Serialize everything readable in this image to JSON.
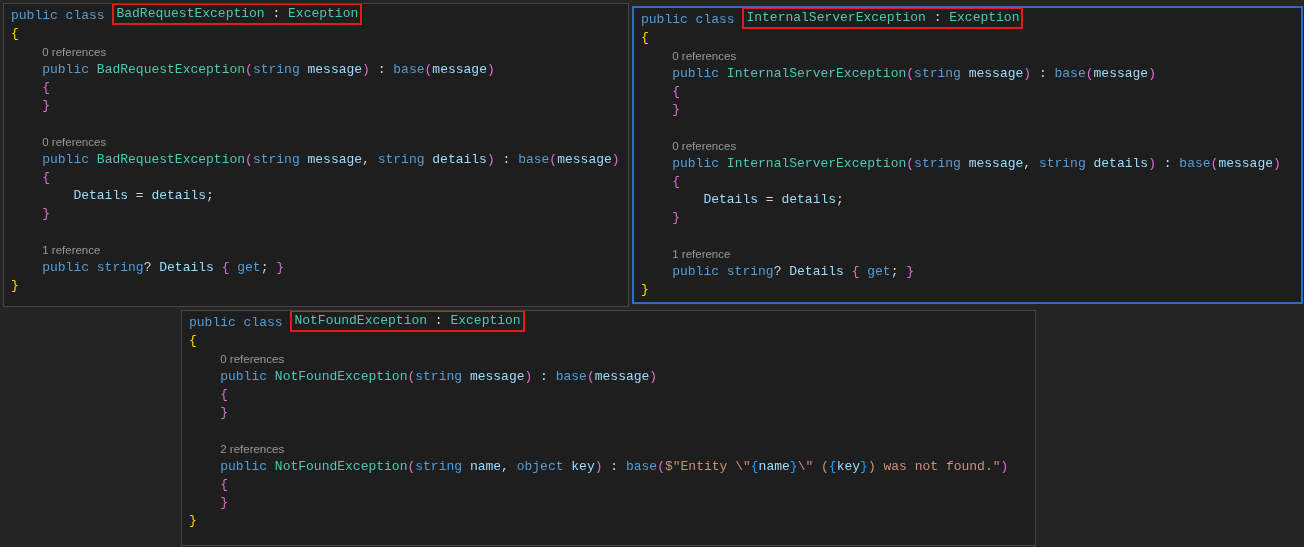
{
  "panels": [
    {
      "selected": false,
      "lines": [
        {
          "kind": "header",
          "tokens": [
            {
              "kind": "kw",
              "text": "public class "
            }
          ],
          "boxed": [
            {
              "kind": "ty",
              "text": "BadRequestException"
            },
            {
              "kind": "p",
              "text": " : "
            },
            {
              "kind": "ty",
              "text": "Exception"
            }
          ]
        },
        {
          "kind": "code",
          "tokens": [
            {
              "kind": "b1",
              "text": "{"
            }
          ]
        },
        {
          "kind": "codelens",
          "text": "    0 references"
        },
        {
          "kind": "code",
          "tokens": [
            {
              "kind": "kw",
              "text": "    public "
            },
            {
              "kind": "ty",
              "text": "BadRequestException"
            },
            {
              "kind": "b2",
              "text": "("
            },
            {
              "kind": "kw",
              "text": "string "
            },
            {
              "kind": "id",
              "text": "message"
            },
            {
              "kind": "b2",
              "text": ")"
            },
            {
              "kind": "p",
              "text": " : "
            },
            {
              "kind": "kw",
              "text": "base"
            },
            {
              "kind": "b2",
              "text": "("
            },
            {
              "kind": "id",
              "text": "message"
            },
            {
              "kind": "b2",
              "text": ")"
            }
          ]
        },
        {
          "kind": "code",
          "tokens": [
            {
              "kind": "b2",
              "text": "    {"
            }
          ]
        },
        {
          "kind": "code",
          "tokens": [
            {
              "kind": "b2",
              "text": "    }"
            }
          ]
        },
        {
          "kind": "blank"
        },
        {
          "kind": "codelens",
          "text": "    0 references"
        },
        {
          "kind": "code",
          "tokens": [
            {
              "kind": "kw",
              "text": "    public "
            },
            {
              "kind": "ty",
              "text": "BadRequestException"
            },
            {
              "kind": "b2",
              "text": "("
            },
            {
              "kind": "kw",
              "text": "string "
            },
            {
              "kind": "id",
              "text": "message"
            },
            {
              "kind": "p",
              "text": ", "
            },
            {
              "kind": "kw",
              "text": "string "
            },
            {
              "kind": "id",
              "text": "details"
            },
            {
              "kind": "b2",
              "text": ")"
            },
            {
              "kind": "p",
              "text": " : "
            },
            {
              "kind": "kw",
              "text": "base"
            },
            {
              "kind": "b2",
              "text": "("
            },
            {
              "kind": "id",
              "text": "message"
            },
            {
              "kind": "b2",
              "text": ")"
            }
          ]
        },
        {
          "kind": "code",
          "tokens": [
            {
              "kind": "b2",
              "text": "    {"
            }
          ]
        },
        {
          "kind": "code",
          "tokens": [
            {
              "kind": "id",
              "text": "        Details"
            },
            {
              "kind": "p",
              "text": " = "
            },
            {
              "kind": "id",
              "text": "details"
            },
            {
              "kind": "p",
              "text": ";"
            }
          ]
        },
        {
          "kind": "code",
          "tokens": [
            {
              "kind": "b2",
              "text": "    }"
            }
          ]
        },
        {
          "kind": "blank"
        },
        {
          "kind": "codelens",
          "text": "    1 reference"
        },
        {
          "kind": "code",
          "tokens": [
            {
              "kind": "kw",
              "text": "    public string"
            },
            {
              "kind": "p",
              "text": "? "
            },
            {
              "kind": "id",
              "text": "Details "
            },
            {
              "kind": "b2",
              "text": "{ "
            },
            {
              "kind": "kw",
              "text": "get"
            },
            {
              "kind": "p",
              "text": "; "
            },
            {
              "kind": "b2",
              "text": "}"
            }
          ]
        },
        {
          "kind": "code",
          "tokens": [
            {
              "kind": "b1",
              "text": "}"
            }
          ]
        }
      ]
    },
    {
      "selected": true,
      "lines": [
        {
          "kind": "header",
          "tokens": [
            {
              "kind": "kw",
              "text": "public class "
            }
          ],
          "boxed": [
            {
              "kind": "ty",
              "text": "InternalServerException"
            },
            {
              "kind": "p",
              "text": " : "
            },
            {
              "kind": "ty",
              "text": "Exception"
            }
          ]
        },
        {
          "kind": "code",
          "tokens": [
            {
              "kind": "b1",
              "text": "{"
            }
          ]
        },
        {
          "kind": "codelens",
          "text": "    0 references"
        },
        {
          "kind": "code",
          "tokens": [
            {
              "kind": "kw",
              "text": "    public "
            },
            {
              "kind": "ty",
              "text": "InternalServerException"
            },
            {
              "kind": "b2",
              "text": "("
            },
            {
              "kind": "kw",
              "text": "string "
            },
            {
              "kind": "id",
              "text": "message"
            },
            {
              "kind": "b2",
              "text": ")"
            },
            {
              "kind": "p",
              "text": " : "
            },
            {
              "kind": "kw",
              "text": "base"
            },
            {
              "kind": "b2",
              "text": "("
            },
            {
              "kind": "id",
              "text": "message"
            },
            {
              "kind": "b2",
              "text": ")"
            }
          ]
        },
        {
          "kind": "code",
          "tokens": [
            {
              "kind": "b2",
              "text": "    {"
            }
          ]
        },
        {
          "kind": "code",
          "tokens": [
            {
              "kind": "b2",
              "text": "    }"
            }
          ]
        },
        {
          "kind": "blank"
        },
        {
          "kind": "codelens",
          "text": "    0 references"
        },
        {
          "kind": "code",
          "tokens": [
            {
              "kind": "kw",
              "text": "    public "
            },
            {
              "kind": "ty",
              "text": "InternalServerException"
            },
            {
              "kind": "b2",
              "text": "("
            },
            {
              "kind": "kw",
              "text": "string "
            },
            {
              "kind": "id",
              "text": "message"
            },
            {
              "kind": "p",
              "text": ", "
            },
            {
              "kind": "kw",
              "text": "string "
            },
            {
              "kind": "id",
              "text": "details"
            },
            {
              "kind": "b2",
              "text": ")"
            },
            {
              "kind": "p",
              "text": " : "
            },
            {
              "kind": "kw",
              "text": "base"
            },
            {
              "kind": "b2",
              "text": "("
            },
            {
              "kind": "id",
              "text": "message"
            },
            {
              "kind": "b2",
              "text": ")"
            }
          ]
        },
        {
          "kind": "code",
          "tokens": [
            {
              "kind": "b2",
              "text": "    {"
            }
          ]
        },
        {
          "kind": "code",
          "tokens": [
            {
              "kind": "id",
              "text": "        Details"
            },
            {
              "kind": "p",
              "text": " = "
            },
            {
              "kind": "id",
              "text": "details"
            },
            {
              "kind": "p",
              "text": ";"
            }
          ]
        },
        {
          "kind": "code",
          "tokens": [
            {
              "kind": "b2",
              "text": "    }"
            }
          ]
        },
        {
          "kind": "blank"
        },
        {
          "kind": "codelens",
          "text": "    1 reference"
        },
        {
          "kind": "code",
          "tokens": [
            {
              "kind": "kw",
              "text": "    public string"
            },
            {
              "kind": "p",
              "text": "? "
            },
            {
              "kind": "id",
              "text": "Details "
            },
            {
              "kind": "b2",
              "text": "{ "
            },
            {
              "kind": "kw",
              "text": "get"
            },
            {
              "kind": "p",
              "text": "; "
            },
            {
              "kind": "b2",
              "text": "}"
            }
          ]
        },
        {
          "kind": "code",
          "tokens": [
            {
              "kind": "b1",
              "text": "}"
            }
          ]
        }
      ]
    },
    {
      "selected": false,
      "lines": [
        {
          "kind": "header",
          "tokens": [
            {
              "kind": "kw",
              "text": "public class "
            }
          ],
          "boxed": [
            {
              "kind": "ty",
              "text": "NotFoundException"
            },
            {
              "kind": "p",
              "text": " : "
            },
            {
              "kind": "ty",
              "text": "Exception"
            }
          ]
        },
        {
          "kind": "code",
          "tokens": [
            {
              "kind": "b1",
              "text": "{"
            }
          ]
        },
        {
          "kind": "codelens",
          "text": "    0 references"
        },
        {
          "kind": "code",
          "tokens": [
            {
              "kind": "kw",
              "text": "    public "
            },
            {
              "kind": "ty",
              "text": "NotFoundException"
            },
            {
              "kind": "b2",
              "text": "("
            },
            {
              "kind": "kw",
              "text": "string "
            },
            {
              "kind": "id",
              "text": "message"
            },
            {
              "kind": "b2",
              "text": ")"
            },
            {
              "kind": "p",
              "text": " : "
            },
            {
              "kind": "kw",
              "text": "base"
            },
            {
              "kind": "b2",
              "text": "("
            },
            {
              "kind": "id",
              "text": "message"
            },
            {
              "kind": "b2",
              "text": ")"
            }
          ]
        },
        {
          "kind": "code",
          "tokens": [
            {
              "kind": "b2",
              "text": "    {"
            }
          ]
        },
        {
          "kind": "code",
          "tokens": [
            {
              "kind": "b2",
              "text": "    }"
            }
          ]
        },
        {
          "kind": "blank"
        },
        {
          "kind": "codelens",
          "text": "    2 references"
        },
        {
          "kind": "code",
          "tokens": [
            {
              "kind": "kw",
              "text": "    public "
            },
            {
              "kind": "ty",
              "text": "NotFoundException"
            },
            {
              "kind": "b2",
              "text": "("
            },
            {
              "kind": "kw",
              "text": "string "
            },
            {
              "kind": "id",
              "text": "name"
            },
            {
              "kind": "p",
              "text": ", "
            },
            {
              "kind": "kw",
              "text": "object "
            },
            {
              "kind": "id",
              "text": "key"
            },
            {
              "kind": "b2",
              "text": ")"
            },
            {
              "kind": "p",
              "text": " : "
            },
            {
              "kind": "kw",
              "text": "base"
            },
            {
              "kind": "b2",
              "text": "("
            },
            {
              "kind": "s",
              "text": "$\"Entity \\\""
            },
            {
              "kind": "b3",
              "text": "{"
            },
            {
              "kind": "id",
              "text": "name"
            },
            {
              "kind": "b3",
              "text": "}"
            },
            {
              "kind": "s",
              "text": "\\\" ("
            },
            {
              "kind": "b3",
              "text": "{"
            },
            {
              "kind": "id",
              "text": "key"
            },
            {
              "kind": "b3",
              "text": "}"
            },
            {
              "kind": "s",
              "text": ") was not found.\""
            },
            {
              "kind": "b2",
              "text": ")"
            }
          ]
        },
        {
          "kind": "code",
          "tokens": [
            {
              "kind": "b2",
              "text": "    {"
            }
          ]
        },
        {
          "kind": "code",
          "tokens": [
            {
              "kind": "b2",
              "text": "    }"
            }
          ]
        },
        {
          "kind": "code",
          "tokens": [
            {
              "kind": "b1",
              "text": "}"
            }
          ]
        }
      ]
    }
  ]
}
